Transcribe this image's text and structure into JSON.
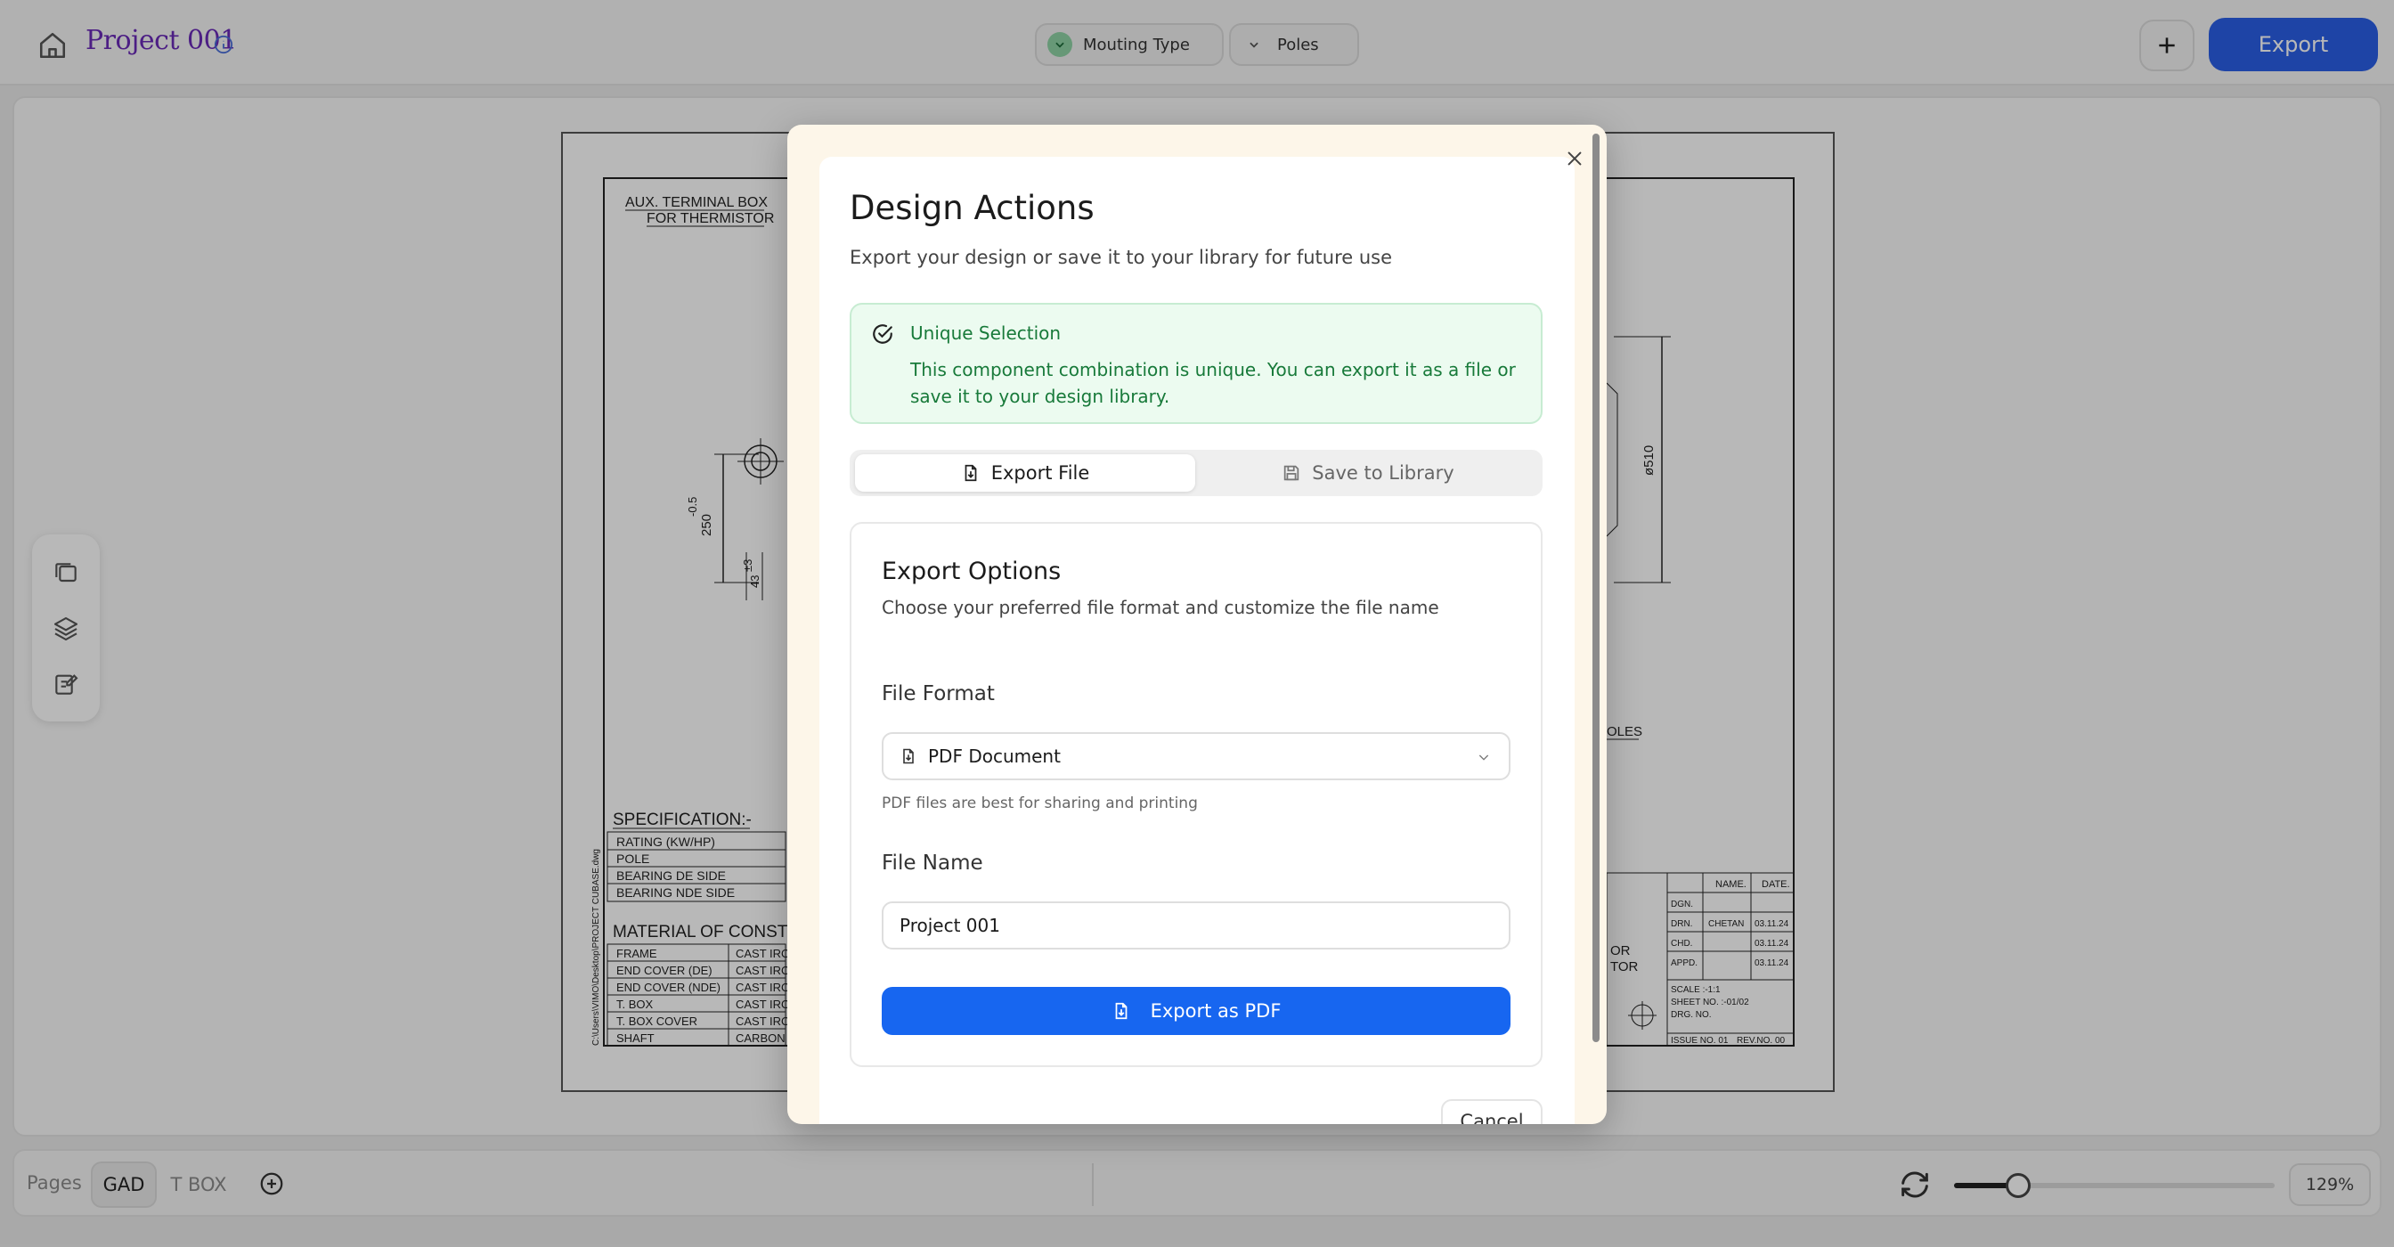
{
  "header": {
    "project_title": "Project 001",
    "filters": [
      {
        "label": "Mouting Type",
        "active": true
      },
      {
        "label": "Poles",
        "active": false
      }
    ],
    "export_label": "Export"
  },
  "drawing": {
    "aux_box_line1": "AUX. TERMINAL BOX",
    "aux_box_line2": "FOR THERMISTOR",
    "spec_title": "SPECIFICATION:-",
    "spec_rows": [
      "RATING (KW/HP)",
      "POLE",
      "BEARING DE SIDE",
      "BEARING NDE SIDE"
    ],
    "material_title": "MATERIAL OF CONSTR",
    "material_rows": [
      {
        "part": "FRAME",
        "material": "CAST IRO"
      },
      {
        "part": "END COVER (DE)",
        "material": "CAST IRO"
      },
      {
        "part": "END COVER (NDE)",
        "material": "CAST IRO"
      },
      {
        "part": "T. BOX",
        "material": "CAST IRO"
      },
      {
        "part": "T. BOX COVER",
        "material": "CAST IRO"
      },
      {
        "part": "SHAFT",
        "material": "CARBON"
      }
    ],
    "dim_250": "250",
    "dim_tol": "-0.5",
    "dim_3": "±3",
    "dim_43": "43",
    "dim_510": "ø510",
    "holes_label": "OLES",
    "title_block": {
      "name_hdr": "NAME.",
      "date_hdr": "DATE.",
      "dgn": "DGN.",
      "drn": "DRN.",
      "drn_name": "CHETAN",
      "drn_date": "03.11.24",
      "chd": "CHD.",
      "chd_date": "03.11.24",
      "appd": "APPD.",
      "appd_date": "03.11.24",
      "scale": "SCALE :-1:1",
      "sheet": "SHEET NO. :-01/02",
      "drg": "DRG. NO.",
      "issue": "ISSUE NO. 01",
      "rev": "REV.NO. 00",
      "or1": "OR",
      "or2": "TOR"
    },
    "side_path": "C:\\Users\\VIMO\\Desktop\\PROJECT CUBASE.dwg"
  },
  "pages": {
    "label": "Pages",
    "tabs": [
      "GAD",
      "T BOX"
    ],
    "active_tab": "GAD"
  },
  "zoom": {
    "value_label": "129%",
    "value": 0.2
  },
  "modal": {
    "title": "Design Actions",
    "subtitle": "Export your design or save it to your library for future use",
    "alert": {
      "title": "Unique Selection",
      "description": "This component combination is unique. You can export it as a file or save it to your design library."
    },
    "tabs": [
      {
        "label": "Export File",
        "active": true
      },
      {
        "label": "Save to Library",
        "active": false
      }
    ],
    "export_options": {
      "title": "Export Options",
      "subtitle": "Choose your preferred file format and customize the file name",
      "file_format_label": "File Format",
      "file_format_value": "PDF Document",
      "file_format_hint": "PDF files are best for sharing and printing",
      "file_name_label": "File Name",
      "file_name_value": "Project 001",
      "export_button": "Export as PDF"
    },
    "cancel_label": "Cancel"
  },
  "colors": {
    "brand_blue": "#1766f0",
    "success_green": "#187a3a",
    "title_purple": "#6a2ab8"
  }
}
